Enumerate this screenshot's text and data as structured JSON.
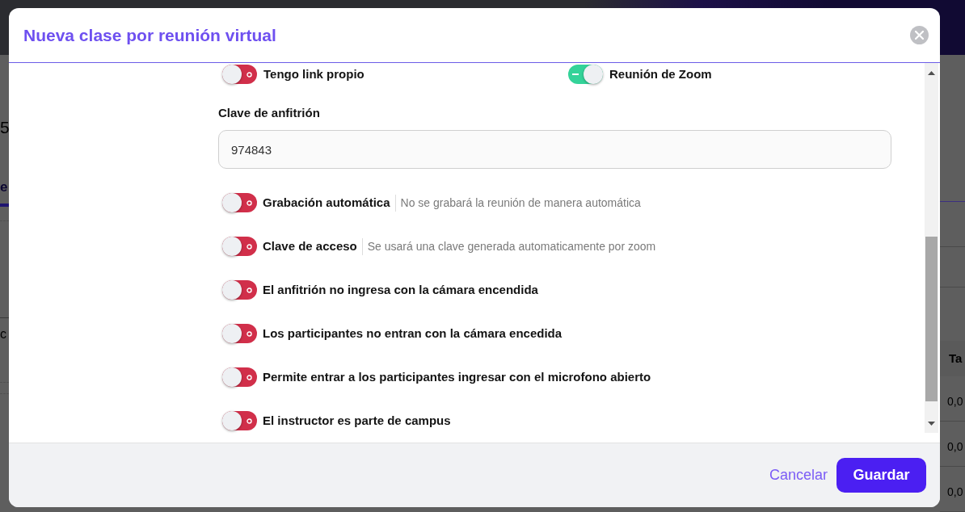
{
  "background_page": {
    "heading_fragment": "5",
    "tab_fragment": "e",
    "row_fragment": "c",
    "table": {
      "column_1_fragment": "Ta",
      "cells": [
        "0,0",
        "0,0",
        "0,0"
      ]
    }
  },
  "dialog": {
    "title": "Nueva clase por reunión virtual"
  },
  "top_toggles": [
    {
      "label": "Tengo link propio",
      "on": false
    },
    {
      "label": "Reunión de Zoom",
      "on": true
    }
  ],
  "host_key": {
    "label": "Clave de anfitrión",
    "value": "974843"
  },
  "options": [
    {
      "label": "Grabación automática",
      "hint": "No se grabará la reunión de manera automática",
      "on": false
    },
    {
      "label": "Clave de acceso",
      "hint": "Se usará una clave generada automaticamente por zoom",
      "on": false
    },
    {
      "label": "El anfitrión no ingresa con la cámara encendida",
      "on": false
    },
    {
      "label": "Los participantes no entran con la cámara encedida",
      "on": false
    },
    {
      "label": "Permite entrar a los participantes ingresar con el microfono abierto",
      "on": false
    },
    {
      "label": "El instructor es parte de campus",
      "on": false
    }
  ],
  "footer": {
    "cancel": "Cancelar",
    "save": "Guardar"
  }
}
